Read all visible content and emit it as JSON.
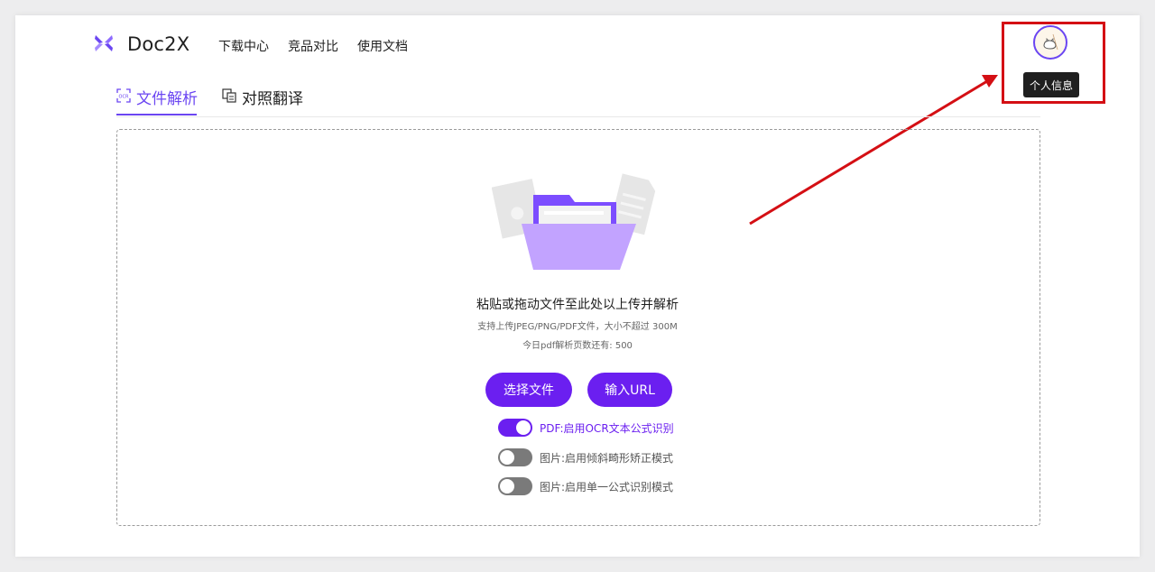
{
  "header": {
    "brand": "Doc2X",
    "nav": [
      "下载中心",
      "竞品对比",
      "使用文档"
    ]
  },
  "profile": {
    "tooltip": "个人信息"
  },
  "tabs": [
    {
      "label": "文件解析",
      "icon": "ocr-icon",
      "active": true
    },
    {
      "label": "对照翻译",
      "icon": "translate-icon",
      "active": false
    }
  ],
  "upload": {
    "headline": "粘贴或拖动文件至此处以上传并解析",
    "supported": "支持上传JPEG/PNG/PDF文件，大小不超过 300M",
    "quota": "今日pdf解析页数还有: 500",
    "choose_button": "选择文件",
    "url_button": "输入URL"
  },
  "toggles": [
    {
      "label": "PDF:启用OCR文本公式识别",
      "on": true
    },
    {
      "label": "图片:启用倾斜畸形矫正模式",
      "on": false
    },
    {
      "label": "图片:启用单一公式识别模式",
      "on": false
    }
  ],
  "colors": {
    "accent": "#6b1ff0",
    "annotation": "#d40f14"
  }
}
